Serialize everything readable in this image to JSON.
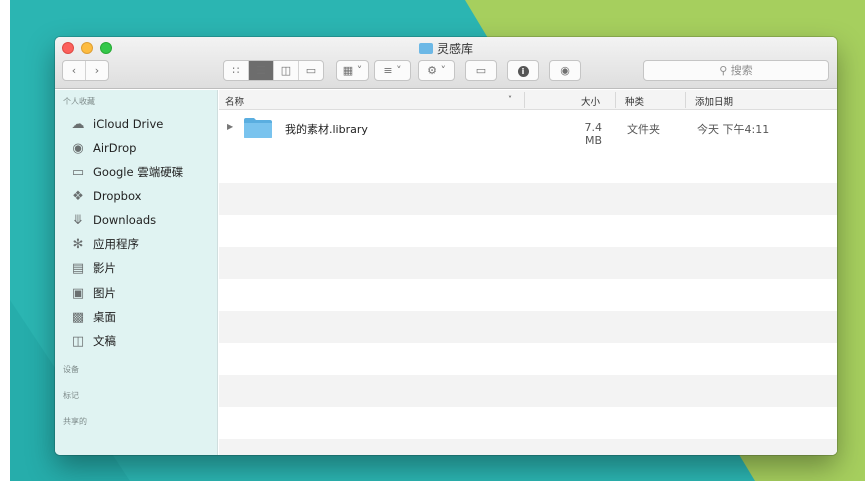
{
  "window": {
    "title": "灵感库",
    "title_icon": "folder-icon"
  },
  "toolbar": {
    "back_icon": "chevron-left-icon",
    "forward_icon": "chevron-right-icon",
    "view_icons": [
      "icon-view-icon",
      "list-view-icon",
      "column-view-icon",
      "cover-flow-icon"
    ],
    "active_view": "list-view-icon",
    "arrange_icon": "arrange-icon",
    "share_icon": "share-icon",
    "action_icon": "gear-icon",
    "tag_icon": "tag-icon",
    "info_icon": "info-icon",
    "quicklook_icon": "eye-icon",
    "search_placeholder": "搜索",
    "search_icon": "search-icon"
  },
  "sidebar": {
    "favorites_heading": "个人收藏",
    "items": [
      {
        "label": "iCloud Drive",
        "icon": "cloud-icon"
      },
      {
        "label": "AirDrop",
        "icon": "airdrop-icon"
      },
      {
        "label": "Google 雲端硬碟",
        "icon": "folder-icon"
      },
      {
        "label": "Dropbox",
        "icon": "dropbox-icon"
      },
      {
        "label": "Downloads",
        "icon": "download-icon"
      },
      {
        "label": "应用程序",
        "icon": "applications-icon"
      },
      {
        "label": "影片",
        "icon": "film-icon"
      },
      {
        "label": "图片",
        "icon": "camera-icon"
      },
      {
        "label": "桌面",
        "icon": "desktop-icon"
      },
      {
        "label": "文稿",
        "icon": "document-icon"
      }
    ],
    "devices_heading": "设备",
    "tags_heading": "标记",
    "shared_heading": "共享的"
  },
  "columns": {
    "name": "名称",
    "size": "大小",
    "kind": "种类",
    "date_added": "添加日期"
  },
  "files": [
    {
      "name": "我的素材.library",
      "size": "7.4 MB",
      "kind": "文件夹",
      "date_added": "今天 下午4:11"
    }
  ],
  "colors": {
    "sidebar_bg": "#e0f3f2",
    "folder_blue": "#6cb8e6",
    "bg_teal": "#27b3b0",
    "bg_green": "#a6cf5e"
  }
}
